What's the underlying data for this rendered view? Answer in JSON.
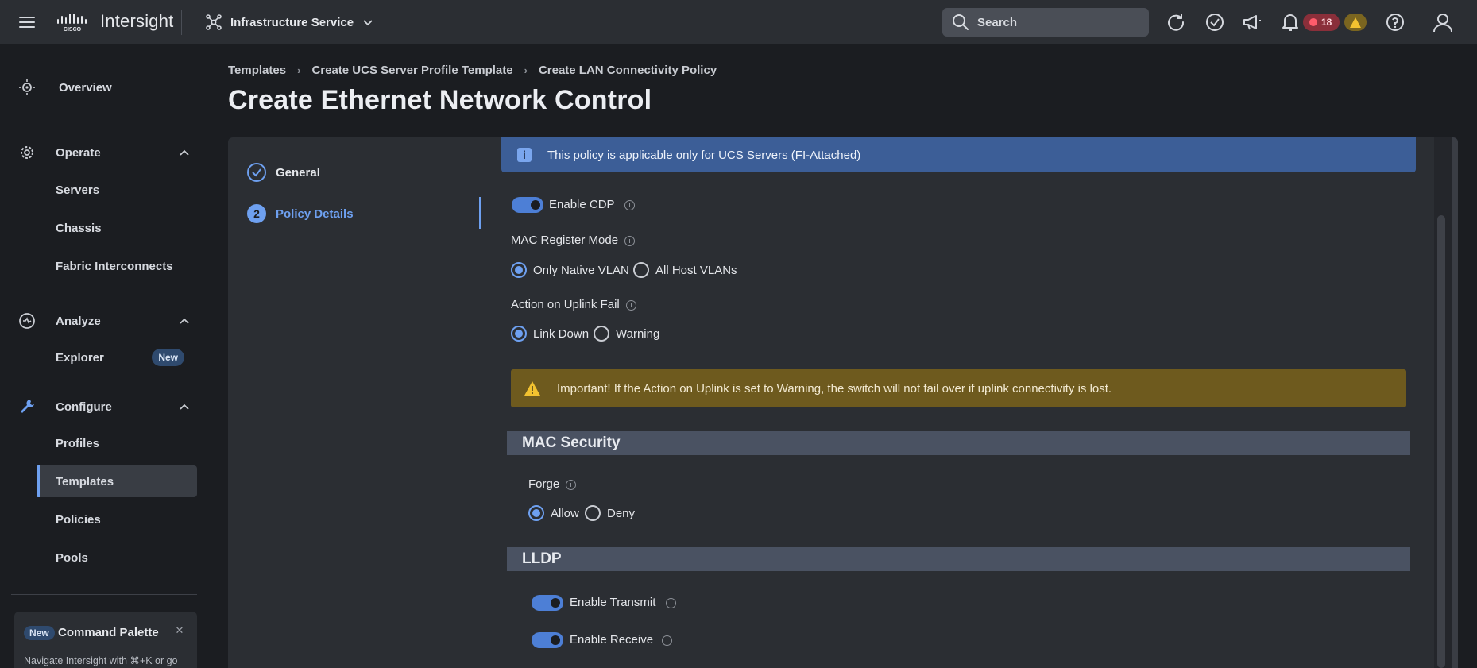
{
  "topbar": {
    "brand": "Intersight",
    "service": "Infrastructure Service",
    "search_placeholder": "Search",
    "critical_count": "18"
  },
  "sidebar": {
    "overview": "Overview",
    "operate": {
      "label": "Operate",
      "items": [
        "Servers",
        "Chassis",
        "Fabric Interconnects"
      ]
    },
    "analyze": {
      "label": "Analyze",
      "items": [
        "Explorer"
      ],
      "new_badge": "New"
    },
    "configure": {
      "label": "Configure",
      "items": [
        "Profiles",
        "Templates",
        "Policies",
        "Pools"
      ],
      "active": "Templates"
    },
    "command_palette": {
      "badge": "New",
      "title": "Command Palette",
      "text": "Navigate Intersight with ⌘+K or go"
    }
  },
  "breadcrumb": [
    "Templates",
    "Create UCS Server Profile Template",
    "Create LAN Connectivity Policy"
  ],
  "page_title": "Create Ethernet Network Control",
  "steps": [
    {
      "number": "1",
      "label": "General",
      "state": "done"
    },
    {
      "number": "2",
      "label": "Policy Details",
      "state": "current"
    }
  ],
  "form": {
    "info_banner": "This policy is applicable only for UCS Servers (FI-Attached)",
    "enable_cdp": {
      "label": "Enable CDP",
      "on": true
    },
    "mac_register_mode": {
      "label": "MAC Register Mode",
      "options": [
        "Only Native VLAN",
        "All Host VLANs"
      ],
      "selected": "Only Native VLAN"
    },
    "action_on_uplink_fail": {
      "label": "Action on Uplink Fail",
      "options": [
        "Link Down",
        "Warning"
      ],
      "selected": "Link Down"
    },
    "warning_banner": "Important! If the Action on Uplink is set to Warning, the switch will not fail over if uplink connectivity is lost.",
    "mac_security": {
      "title": "MAC Security",
      "forge": {
        "label": "Forge",
        "options": [
          "Allow",
          "Deny"
        ],
        "selected": "Allow"
      }
    },
    "lldp": {
      "title": "LLDP",
      "enable_transmit": {
        "label": "Enable Transmit",
        "on": true
      },
      "enable_receive": {
        "label": "Enable Receive",
        "on": true
      }
    }
  },
  "colors": {
    "accent": "#6ea0f0",
    "info_banner": "#3c5e97",
    "warning_banner": "#6e5a1e",
    "critical": "#ff5b6b",
    "warning_icon": "#f2c230"
  }
}
